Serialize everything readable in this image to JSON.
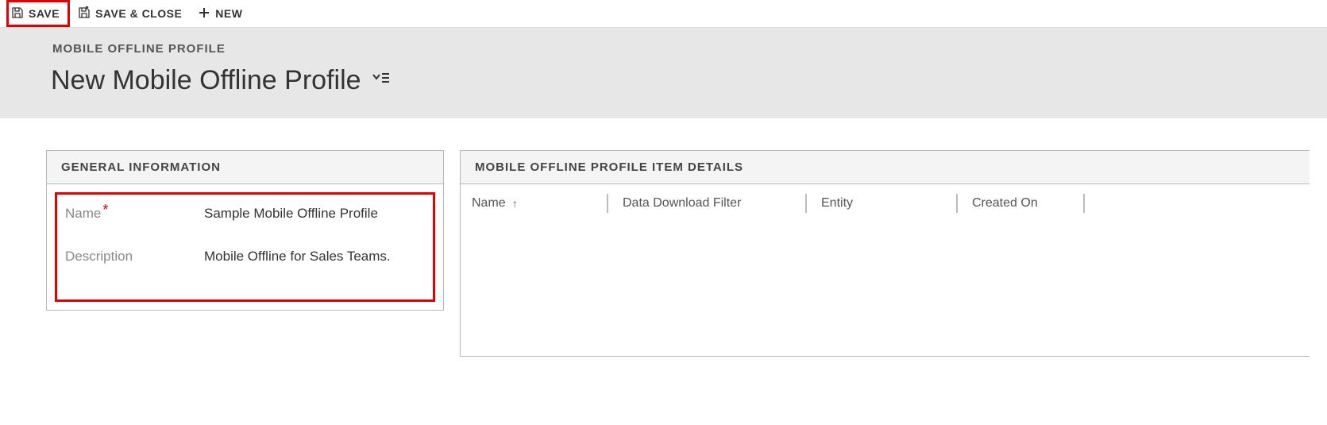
{
  "toolbar": {
    "save_label": "SAVE",
    "save_close_label": "SAVE & CLOSE",
    "new_label": "NEW"
  },
  "header": {
    "subtitle": "MOBILE OFFLINE PROFILE",
    "title": "New Mobile Offline Profile"
  },
  "general": {
    "panel_title": "GENERAL INFORMATION",
    "name_label": "Name",
    "name_value": "Sample Mobile Offline Profile",
    "description_label": "Description",
    "description_value": "Mobile Offline for Sales Teams."
  },
  "details": {
    "panel_title": "MOBILE OFFLINE PROFILE ITEM DETAILS",
    "columns": {
      "name": "Name",
      "filter": "Data Download Filter",
      "entity": "Entity",
      "created": "Created On"
    },
    "sort_indicator": "↑"
  }
}
